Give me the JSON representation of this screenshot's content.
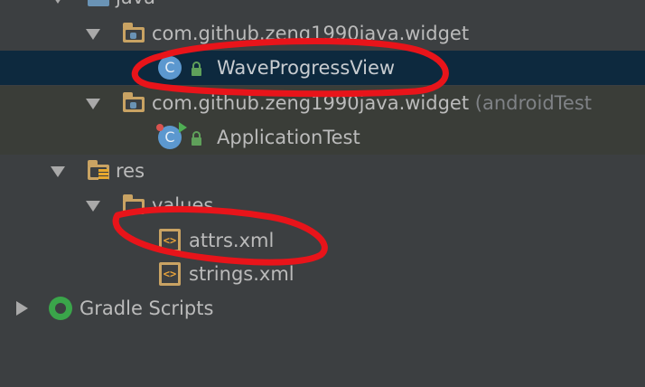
{
  "tree": {
    "java_folder": "java",
    "pkg_main": "com.github.zeng1990java.widget",
    "class_main": "WaveProgressView",
    "pkg_test": "com.github.zeng1990java.widget",
    "pkg_test_suffix": "(androidTest",
    "class_test": "ApplicationTest",
    "res_folder": "res",
    "values_folder": "values",
    "file_attrs": "attrs.xml",
    "file_strings": "strings.xml",
    "gradle_scripts": "Gradle Scripts"
  },
  "icons": {
    "class_letter": "C",
    "xml_symbol": "<>"
  },
  "colors": {
    "background": "#3c3f41",
    "selection": "#0d293e",
    "annotation_red": "#e8141a"
  }
}
